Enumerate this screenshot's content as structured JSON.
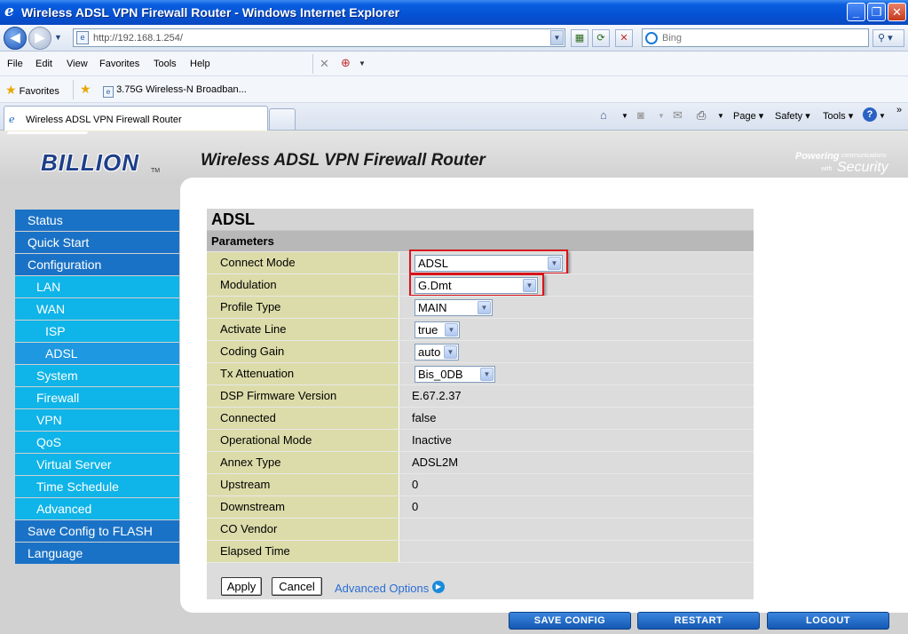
{
  "window": {
    "title": "Wireless ADSL VPN Firewall Router - Windows Internet Explorer",
    "address": "http://192.168.1.254/",
    "search_placeholder": "Bing",
    "minimize": "_",
    "maximize": "❐",
    "close": "✕"
  },
  "menu": [
    "File",
    "Edit",
    "View",
    "Favorites",
    "Tools",
    "Help"
  ],
  "favorites": {
    "label": "Favorites",
    "link": "3.75G Wireless-N Broadban..."
  },
  "tab": {
    "title": "Wireless ADSL VPN Firewall Router"
  },
  "commands": {
    "page": "Page",
    "safety": "Safety",
    "tools": "Tools"
  },
  "header": {
    "brand": "BILLION",
    "tm": "TM",
    "heading": "Wireless ADSL VPN Firewall Router",
    "tagline_powering": "Powering",
    "tagline_communications": "communications",
    "tagline_with": "with",
    "tagline_security": "Security"
  },
  "sidebar": {
    "items": [
      {
        "label": "Status",
        "level": 1
      },
      {
        "label": "Quick Start",
        "level": 1
      },
      {
        "label": "Configuration",
        "level": 1
      },
      {
        "label": "LAN",
        "level": 2
      },
      {
        "label": "WAN",
        "level": 2
      },
      {
        "label": "ISP",
        "level": 3
      },
      {
        "label": "ADSL",
        "level": 3,
        "active": true
      },
      {
        "label": "System",
        "level": 2
      },
      {
        "label": "Firewall",
        "level": 2
      },
      {
        "label": "VPN",
        "level": 2
      },
      {
        "label": "QoS",
        "level": 2
      },
      {
        "label": "Virtual Server",
        "level": 2
      },
      {
        "label": "Time Schedule",
        "level": 2
      },
      {
        "label": "Advanced",
        "level": 2
      },
      {
        "label": "Save Config to FLASH",
        "level": 1
      },
      {
        "label": "Language",
        "level": 1
      }
    ]
  },
  "panel": {
    "title": "ADSL",
    "section": "Parameters",
    "rows": [
      {
        "label": "Connect Mode",
        "value": "ADSL"
      },
      {
        "label": "Modulation",
        "value": "G.Dmt"
      },
      {
        "label": "Profile Type",
        "value": "MAIN"
      },
      {
        "label": "Activate Line",
        "value": "true"
      },
      {
        "label": "Coding Gain",
        "value": "auto"
      },
      {
        "label": "Tx Attenuation",
        "value": "Bis_0DB"
      },
      {
        "label": "DSP Firmware Version",
        "value": "E.67.2.37"
      },
      {
        "label": "Connected",
        "value": "false"
      },
      {
        "label": "Operational Mode",
        "value": "Inactive"
      },
      {
        "label": "Annex Type",
        "value": "ADSL2M"
      },
      {
        "label": "Upstream",
        "value": "0"
      },
      {
        "label": "Downstream",
        "value": "0"
      },
      {
        "label": "CO Vendor",
        "value": ""
      },
      {
        "label": "Elapsed Time",
        "value": ""
      }
    ],
    "apply": "Apply",
    "cancel": "Cancel",
    "advanced_options": "Advanced Options"
  },
  "footer": {
    "save_config": "SAVE CONFIG",
    "restart": "RESTART",
    "logout": "LOGOUT"
  },
  "colors": {
    "nav_primary": "#1a72c6",
    "nav_secondary": "#0fb4e8",
    "label_cell": "#dcdcaa",
    "highlight": "#d8141b"
  }
}
